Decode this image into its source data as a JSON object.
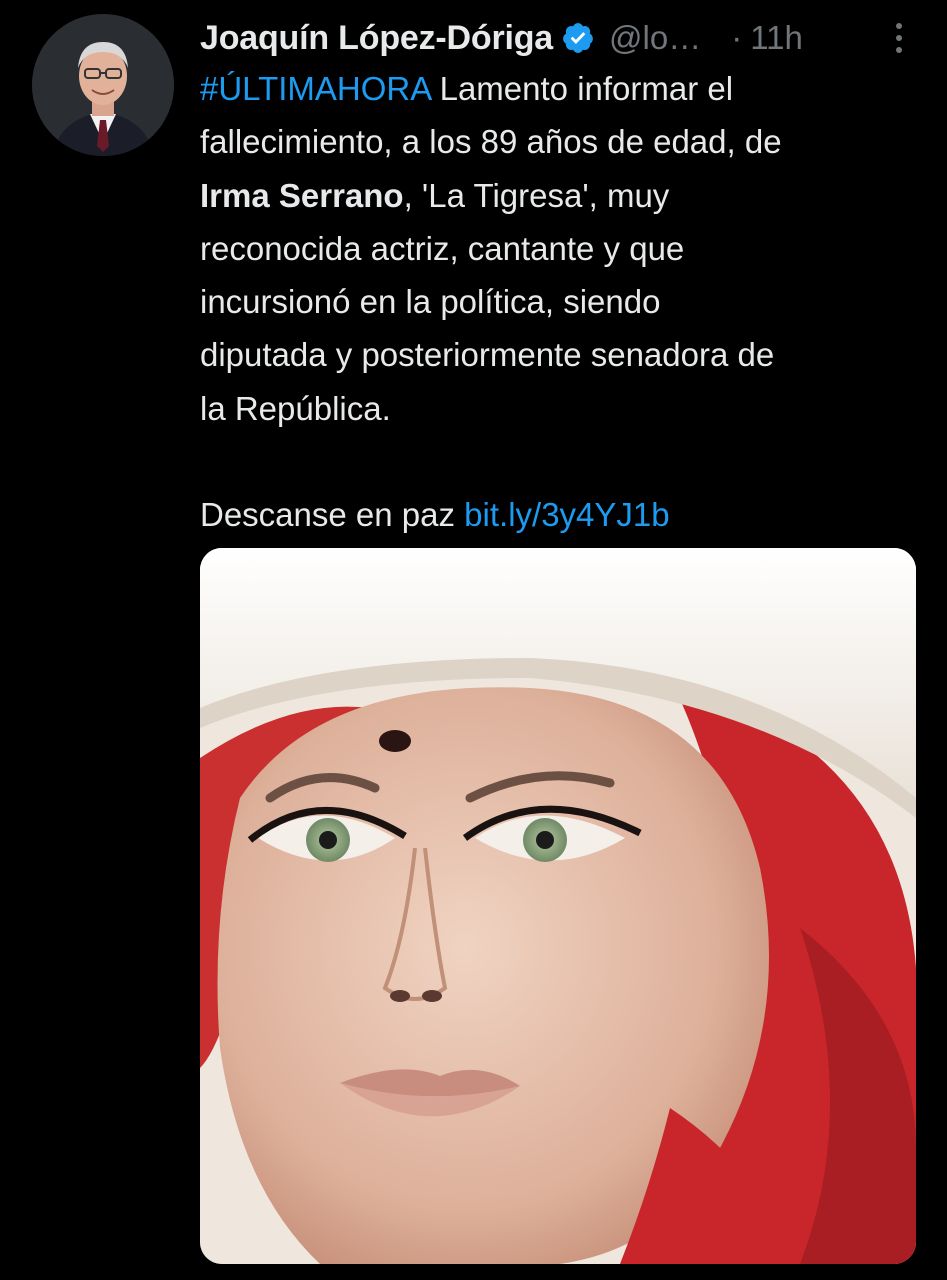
{
  "tweet": {
    "author": {
      "display_name": "Joaquín López-Dóriga",
      "handle": "@lo…",
      "verified": true
    },
    "separator": "·",
    "timestamp": "11h",
    "text": {
      "hashtag": "#ÚLTIMAHORA",
      "line1_rest": " Lamento informar el",
      "line2": "fallecimiento, a los 89 años de edad, de",
      "line3_bold": "Irma Serrano",
      "line3_rest": ", 'La Tigresa', muy",
      "line4": "reconocida actriz, cantante y que",
      "line5": "incursionó en la política, siendo",
      "line6": "diputada y posteriormente senadora de",
      "line7": "la República.",
      "closing": "Descanse en paz ",
      "link": "bit.ly/3y4YJ1b"
    },
    "icons": {
      "verified_badge": "verified-badge-icon",
      "more": "more-options-icon"
    },
    "colors": {
      "background": "#000000",
      "text": "#e7e9ea",
      "secondary": "#71767b",
      "accent": "#1d9bf0"
    }
  }
}
